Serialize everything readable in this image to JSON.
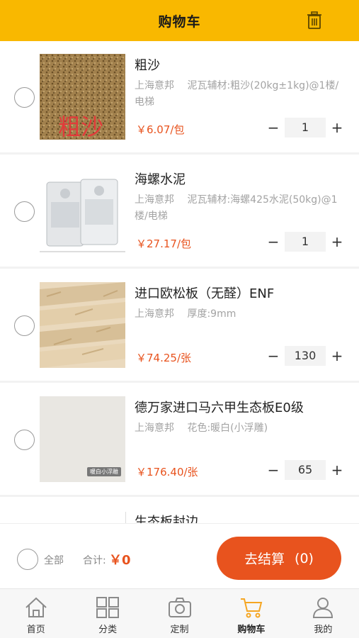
{
  "header": {
    "title": "购物车"
  },
  "items": [
    {
      "name": "粗沙",
      "spec": "上海意邦　 泥瓦辅材:粗沙(20kg±1kg)@1楼/电梯",
      "price": "￥6.07/包",
      "qty": "1",
      "image_text": "粗沙"
    },
    {
      "name": "海螺水泥",
      "spec": "上海意邦　 泥瓦辅材:海螺425水泥(50kg)@1楼/电梯",
      "price": "￥27.17/包",
      "qty": "1"
    },
    {
      "name": "进口欧松板（无醛）ENF",
      "spec": "上海意邦　 厚度:9mm",
      "price": "￥74.25/张",
      "qty": "130"
    },
    {
      "name": "德万家进口马六甲生态板E0级",
      "spec": "上海意邦　 花色:暖白(小浮雕)",
      "price": "￥176.40/张",
      "qty": "65",
      "image_tag": "暖白小浮雕"
    },
    {
      "name": "生态板封边"
    }
  ],
  "qty_controls": {
    "minus": "−",
    "plus": "+"
  },
  "footer": {
    "select_all": "全部",
    "total_label": "合计:",
    "total_value": "￥0",
    "checkout_label": "去结算",
    "checkout_count": "(0)"
  },
  "tabs": [
    {
      "label": "首页",
      "icon": "home-icon"
    },
    {
      "label": "分类",
      "icon": "category-icon"
    },
    {
      "label": "定制",
      "icon": "camera-icon"
    },
    {
      "label": "购物车",
      "icon": "cart-icon",
      "active": true
    },
    {
      "label": "我的",
      "icon": "user-icon"
    }
  ],
  "colors": {
    "header": "#f9b800",
    "accent": "#e8531e",
    "cart_active": "#f5a623"
  }
}
